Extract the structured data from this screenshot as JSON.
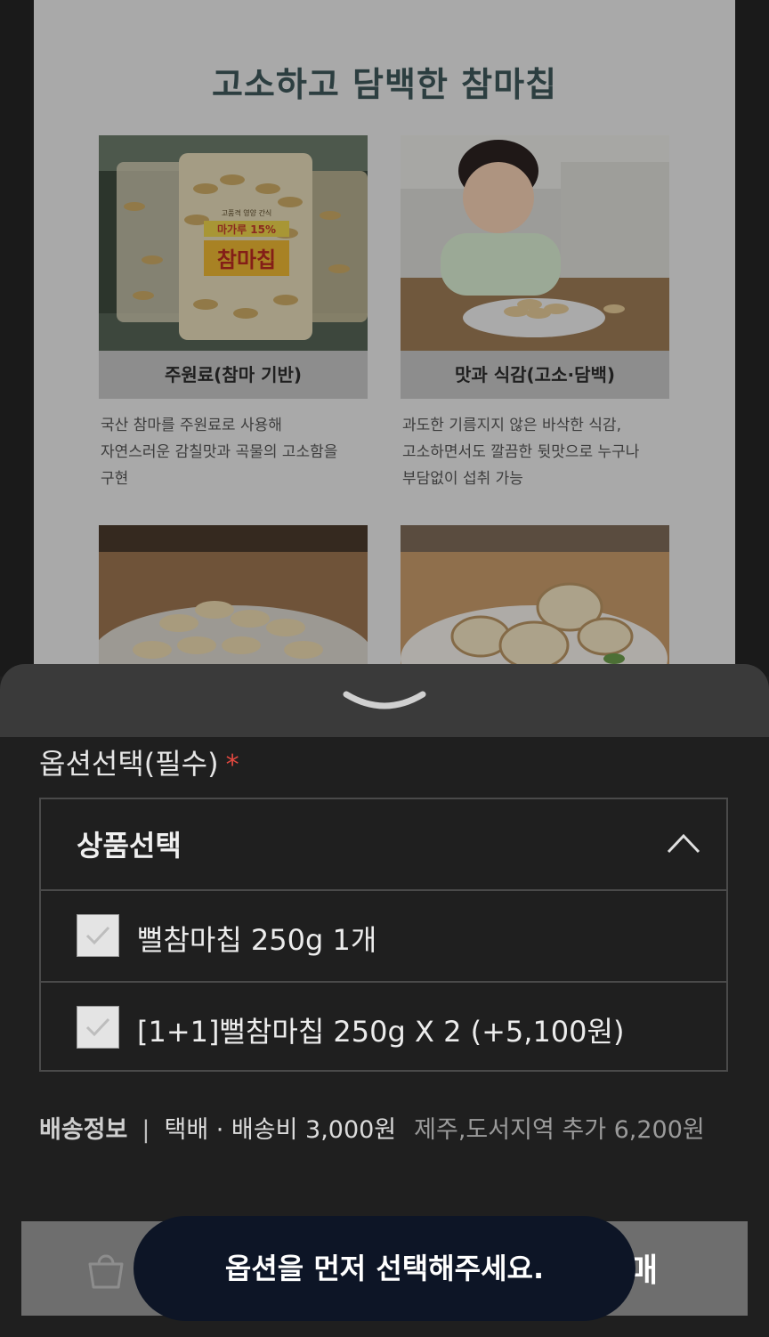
{
  "product_page": {
    "section_title": "고소하고 담백한 참마칩",
    "cards": [
      {
        "caption": "주원료(참마 기반)",
        "description": "국산 참마를 주원료로 사용해\n자연스러운 감칠맛과 곡물의 고소함을\n구현",
        "package_label_top": "고품격 영양 간식",
        "package_label_mid": "마가루 15%",
        "package_label_main": "참마칩"
      },
      {
        "caption": "맛과 식감(고소·담백)",
        "description": "과도한 기름지지 않은 바삭한 식감,\n고소하면서도 깔끔한 뒷맛으로 누구나\n부담없이 섭취 가능"
      }
    ]
  },
  "options": {
    "label": "옵션선택(필수)",
    "required_mark": "*",
    "dropdown_title": "상품선택",
    "items": [
      {
        "label": "뻘참마칩 250g 1개"
      },
      {
        "label": "[1+1]뻘참마칩 250g X 2 (+5,100원)"
      }
    ]
  },
  "delivery": {
    "label": "배송정보",
    "separator": "|",
    "method": "택배 · 배송비 3,000원",
    "extra": "제주,도서지역 추가 6,200원"
  },
  "action_bar": {
    "buy_label_visible": "매"
  },
  "toast": {
    "message": "옵션을 먼저 선택해주세요."
  }
}
